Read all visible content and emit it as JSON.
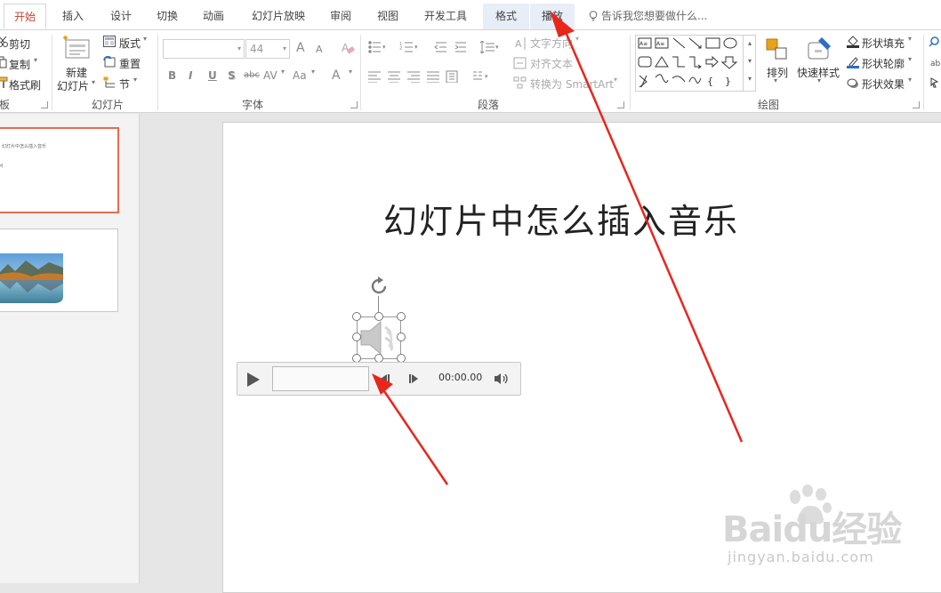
{
  "tabs": [
    {
      "label": "开始",
      "active": true
    },
    {
      "label": "插入"
    },
    {
      "label": "设计"
    },
    {
      "label": "切换"
    },
    {
      "label": "动画"
    },
    {
      "label": "幻灯片放映"
    },
    {
      "label": "审阅"
    },
    {
      "label": "视图"
    },
    {
      "label": "开发工具"
    },
    {
      "label": "格式",
      "contextual": true
    },
    {
      "label": "播放",
      "contextual": true
    }
  ],
  "tell_me": "告诉我您想要做什么...",
  "ribbon": {
    "clipboard": {
      "cut": "剪切",
      "copy": "复制",
      "format_painter": "格式刷",
      "group_label": "板"
    },
    "slides": {
      "new_slide_line1": "新建",
      "new_slide_line2": "幻灯片",
      "layout": "版式",
      "reset": "重置",
      "section": "节",
      "group_label": "幻灯片"
    },
    "font": {
      "size": "44",
      "group_label": "字体",
      "bold": "B",
      "italic": "I",
      "underline": "U",
      "shadow": "S",
      "strike": "abc",
      "spacing": "AV",
      "case": "Aa",
      "color": "A",
      "grow": "A",
      "shrink": "A"
    },
    "paragraph": {
      "text_direction": "文字方向",
      "align_text": "对齐文本",
      "convert_smartart": "转换为 SmartArt",
      "group_label": "段落"
    },
    "drawing": {
      "arrange": "排列",
      "quick_styles": "快速样式",
      "shape_fill": "形状填充",
      "shape_outline": "形状轮廓",
      "shape_effects": "形状效果",
      "group_label": "绘图"
    }
  },
  "slide": {
    "title": "幻灯片中怎么插入音乐",
    "thumb_title": "幻灯片中怎么插入音乐"
  },
  "player": {
    "time": "00:00.00"
  },
  "watermark": {
    "brand": "Baidu经验",
    "url": "jingyan.baidu.com"
  },
  "colors": {
    "accent": "#c4432b",
    "selected_thumb_border": "#e36c4f",
    "annotation_arrow": "#e8261c",
    "contextual_tab_bg": "#e8eef8"
  },
  "icons": [
    "cut-icon",
    "copy-icon",
    "format-painter-icon",
    "new-slide-icon",
    "layout-icon",
    "reset-icon",
    "section-icon",
    "speaker-icon",
    "play-icon",
    "rewind-icon",
    "forward-icon",
    "volume-icon",
    "rotate-icon",
    "lightbulb-icon"
  ]
}
